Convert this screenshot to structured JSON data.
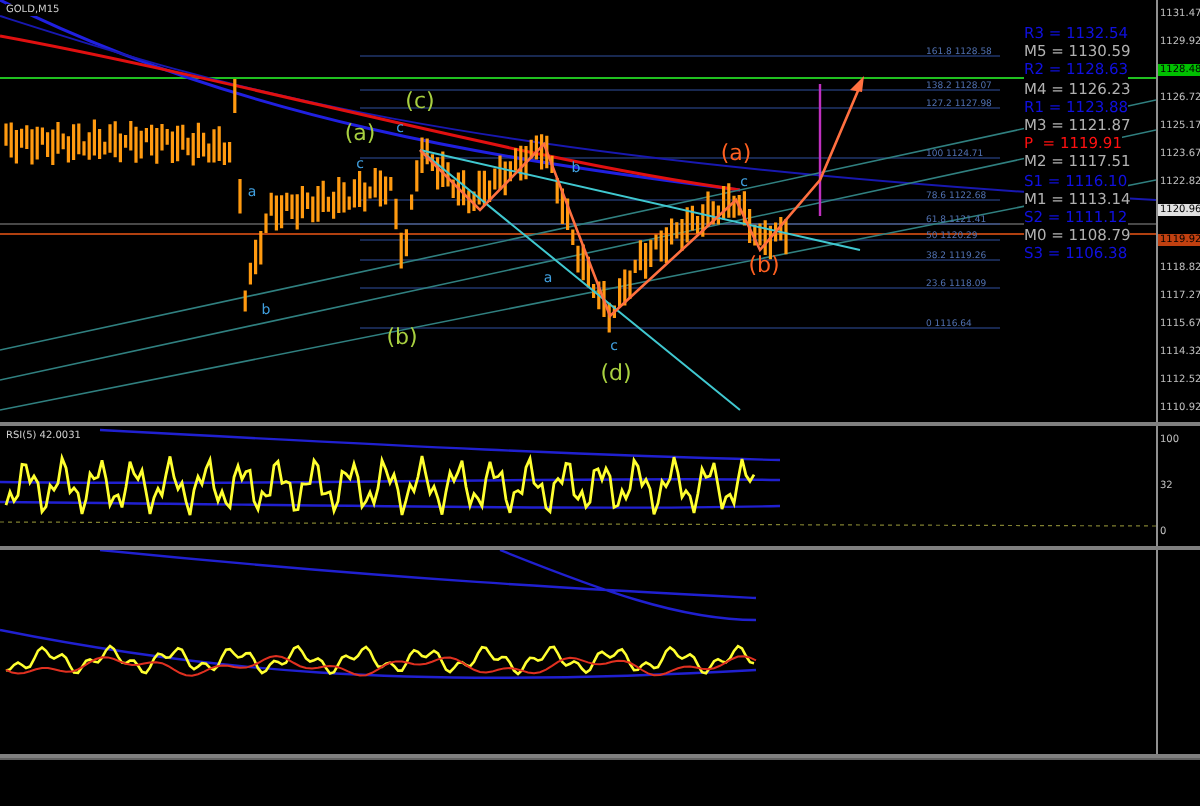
{
  "chart_title": "GOLD,M15",
  "price_axis": [
    {
      "kind": "tick",
      "label": "1131.47"
    },
    {
      "kind": "tick",
      "label": "1129.92"
    },
    {
      "kind": "tag",
      "label": "1128.48",
      "color": "#00c000"
    },
    {
      "kind": "tick",
      "label": "1126.72"
    },
    {
      "kind": "tick",
      "label": "1125.17"
    },
    {
      "kind": "tick",
      "label": "1123.67"
    },
    {
      "kind": "tick",
      "label": "1122.82"
    },
    {
      "kind": "tag",
      "label": "1120.96",
      "color": "#e0e0e0"
    },
    {
      "kind": "tag",
      "label": "1119.92",
      "color": "#c04010"
    },
    {
      "kind": "tick",
      "label": "1118.82"
    },
    {
      "kind": "tick",
      "label": "1117.27"
    },
    {
      "kind": "tick",
      "label": "1115.67"
    },
    {
      "kind": "tick",
      "label": "1114.32"
    },
    {
      "kind": "tick",
      "label": "1112.52"
    },
    {
      "kind": "tick",
      "label": "1110.92"
    }
  ],
  "pivot_levels": [
    {
      "label": "R3 = 1132.54",
      "color": "#1010e0"
    },
    {
      "label": "M5 = 1130.59",
      "color": "#b0b0b0"
    },
    {
      "label": "R2 = 1128.63",
      "color": "#1010e0"
    },
    {
      "label": "M4 = 1126.23",
      "color": "#b0b0b0"
    },
    {
      "label": "R1 = 1123.88",
      "color": "#1010e0"
    },
    {
      "label": "M3 = 1121.87",
      "color": "#b0b0b0"
    },
    {
      "label": "P  = 1119.91",
      "color": "#ff1010"
    },
    {
      "label": "M2 = 1117.51",
      "color": "#b0b0b0"
    },
    {
      "label": "S1 = 1116.10",
      "color": "#1010e0"
    },
    {
      "label": "M1 = 1113.14",
      "color": "#b0b0b0"
    },
    {
      "label": "S2 = 1111.12",
      "color": "#1010e0"
    },
    {
      "label": "M0 = 1108.79",
      "color": "#b0b0b0"
    },
    {
      "label": "S3 = 1106.38",
      "color": "#1010e0"
    }
  ],
  "fib_levels": [
    "161.8 1128.58",
    "138.2 1128.07",
    "127.2 1127.98",
    "100 1124.71",
    "78.6 1122.68",
    "61.8 1121.41",
    "50 1120.29",
    "38.2 1119.26",
    "23.6 1118.09",
    "0 1116.64"
  ],
  "wave_labels": [
    {
      "label": "(a)",
      "color": "#a8d040"
    },
    {
      "label": "(c)",
      "color": "#a8d040"
    },
    {
      "label": "(b)",
      "color": "#a8d040"
    },
    {
      "label": "(d)",
      "color": "#a8d040"
    },
    {
      "label": "(a)",
      "color": "#ff6020"
    },
    {
      "label": "(b)",
      "color": "#ff6020"
    },
    {
      "label": "c",
      "color": "#40a0e0"
    },
    {
      "label": "c",
      "color": "#40a0e0"
    },
    {
      "label": "b",
      "color": "#40a0e0"
    },
    {
      "label": "a",
      "color": "#40a0e0"
    },
    {
      "label": "c",
      "color": "#40a0e0"
    },
    {
      "label": "c",
      "color": "#40a0e0"
    },
    {
      "label": "b",
      "color": "#40a0e0"
    },
    {
      "label": "a",
      "color": "#40a0e0"
    }
  ],
  "rsi": {
    "title": "RSI(5) 42.0031",
    "axis": [
      "100",
      "32",
      "0"
    ]
  }
}
